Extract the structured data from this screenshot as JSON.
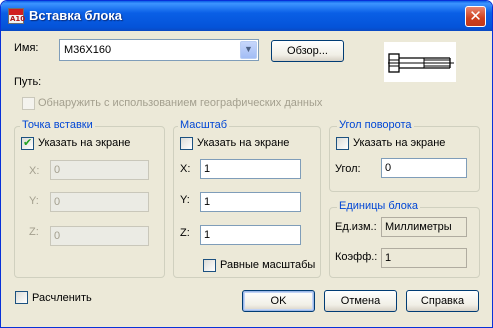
{
  "window": {
    "title": "Вставка блока"
  },
  "name_row": {
    "label": "Имя:",
    "value": "M36X160",
    "browse_button": "Обзор..."
  },
  "path_label": "Путь:",
  "geo_checkbox": {
    "label": "Обнаружить с использованием географических данных",
    "checked": false,
    "enabled": false
  },
  "insert_point": {
    "title": "Точка вставки",
    "on_screen": "Указать на экране",
    "on_screen_checked": true,
    "x_label": "X:",
    "x_value": "0",
    "y_label": "Y:",
    "y_value": "0",
    "z_label": "Z:",
    "z_value": "0"
  },
  "scale": {
    "title": "Масштаб",
    "on_screen": "Указать на экране",
    "on_screen_checked": false,
    "x_label": "X:",
    "x_value": "1",
    "y_label": "Y:",
    "y_value": "1",
    "z_label": "Z:",
    "z_value": "1",
    "uniform": "Равные масштабы",
    "uniform_checked": false
  },
  "rotation": {
    "title": "Угол поворота",
    "on_screen": "Указать на экране",
    "on_screen_checked": false,
    "angle_label": "Угол:",
    "angle_value": "0"
  },
  "units": {
    "title": "Единицы блока",
    "unit_label": "Ед.изм.:",
    "unit_value": "Миллиметры",
    "factor_label": "Коэфф.:",
    "factor_value": "1"
  },
  "explode": {
    "label": "Расчленить",
    "checked": false
  },
  "buttons": {
    "ok": "OK",
    "cancel": "Отмена",
    "help": "Справка"
  }
}
